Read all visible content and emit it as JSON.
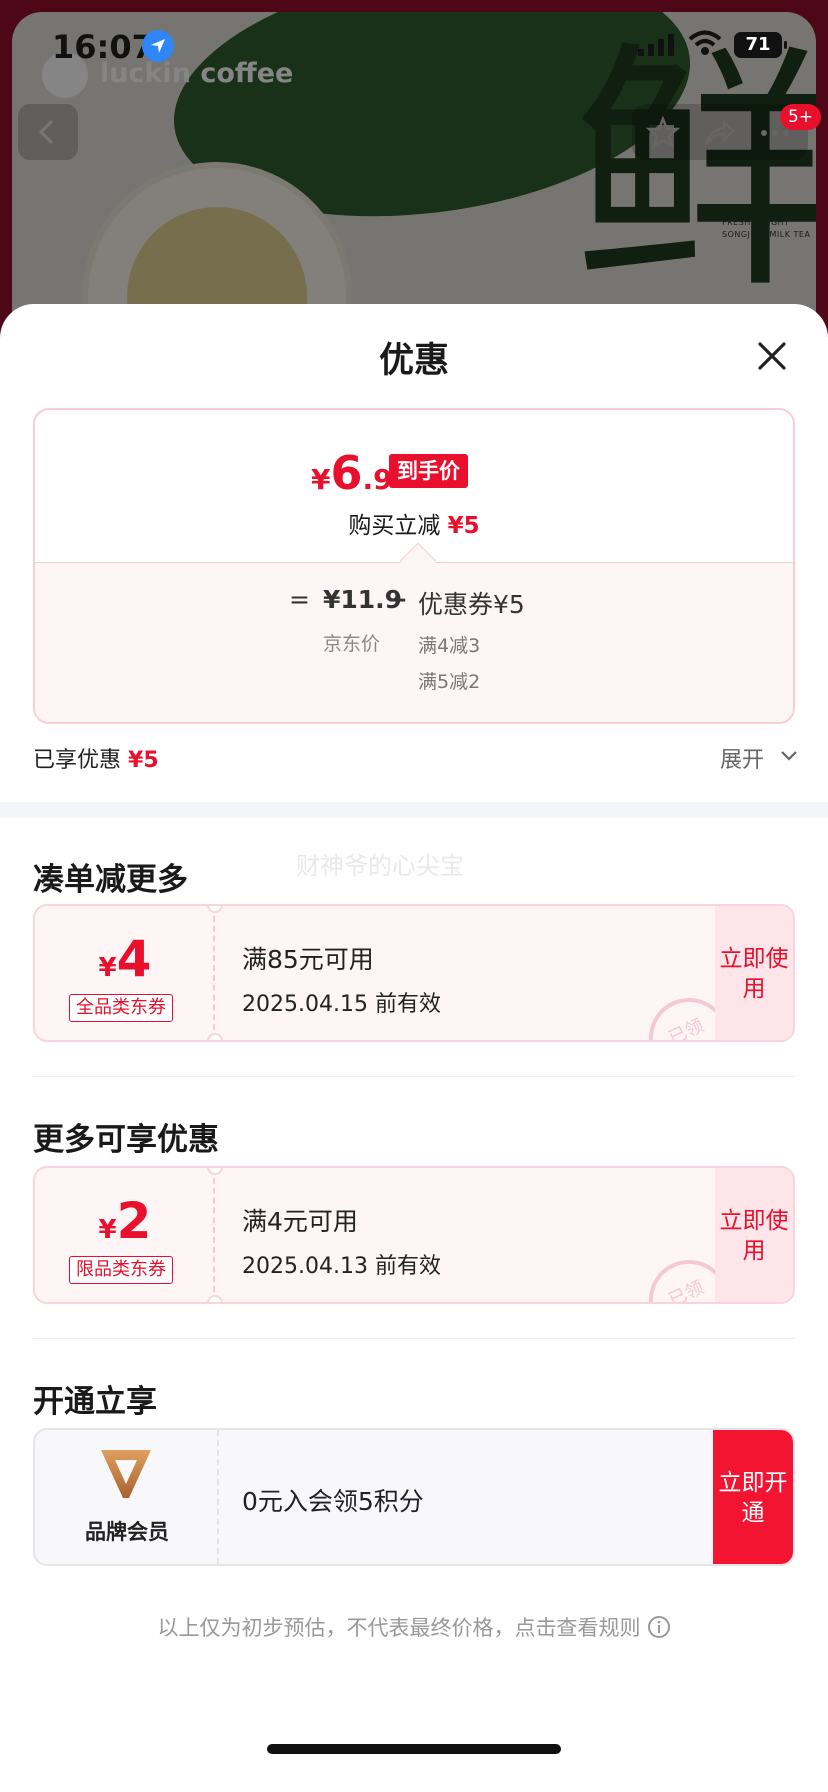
{
  "status_bar": {
    "time": "16:07",
    "battery": "71"
  },
  "background": {
    "brand": "luckin coffee",
    "hero_char": "鲜",
    "tagline": "FRESHLY LIGHT SONGJING MILK TEA",
    "badge": "5+"
  },
  "sheet": {
    "title": "优惠",
    "price": {
      "currency": "¥",
      "final_int": "6",
      "final_dec": ".9",
      "final_tag": "到手价",
      "reduce_label": "购买立减",
      "reduce_value": "¥5",
      "equals": "=",
      "jd_price": "¥11.9",
      "jd_price_label": "京东价",
      "minus": "−",
      "coupon_label": "优惠券¥5",
      "rule_1": "满4减3",
      "rule_2": "满5减2"
    },
    "enjoyed_label": "已享优惠",
    "enjoyed_value": "¥5",
    "expand_label": "展开",
    "watermark": "财神爷的心尖宝",
    "sections": [
      {
        "title": "凑单减更多",
        "coupon": {
          "currency": "¥",
          "amount": "4",
          "type": "全品类东券",
          "condition": "满85元可用",
          "valid": "2025.04.15 前有效",
          "stamp": "已领",
          "button": "立即使用"
        }
      },
      {
        "title": "更多可享优惠",
        "coupon": {
          "currency": "¥",
          "amount": "2",
          "type": "限品类东券",
          "condition": "满4元可用",
          "valid": "2025.04.13 前有效",
          "stamp": "已领",
          "button": "立即使用"
        }
      },
      {
        "title": "开通立享",
        "member": {
          "name": "品牌会员",
          "text": "0元入会领5积分",
          "button": "立即开通"
        }
      }
    ],
    "footer_note": "以上仅为初步预估，不代表最终价格，点击查看规则"
  },
  "colors": {
    "accent": "#e8102c",
    "coupon_bg": "#fdf5f6",
    "border": "#f9cdd5"
  }
}
